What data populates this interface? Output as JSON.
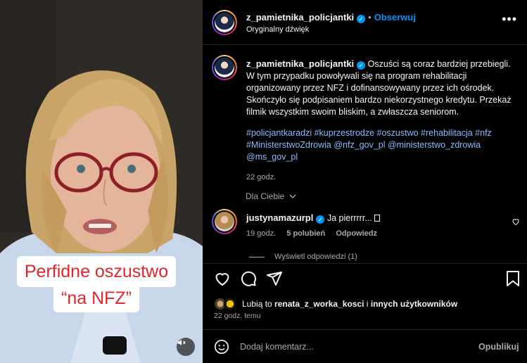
{
  "video": {
    "caption_line1": "Perfidne oszustwo",
    "caption_line2": "“na NFZ”"
  },
  "header": {
    "username": "z_pamietnika_policjantki",
    "separator": "•",
    "follow_label": "Obserwuj",
    "audio_label": "Oryginalny dźwięk",
    "more_label": "•••"
  },
  "post": {
    "username": "z_pamietnika_policjantki",
    "text": "Oszuści są coraz bardziej przebiegli. W tym przypadku powoływali się na program rehabilitacji organizowany przez NFZ i dofinansowywany przez ich ośrodek. Skończyło się podpisaniem bardzo niekorzystnego kredytu. Przekaż filmik wszystkim swoim bliskim, a zwłaszcza seniorom.",
    "hashtags": "#policjantkaradzi #kuprzestrodze #oszustwo #rehabilitacja #nfz #MinisterstwoZdrowia @nfz_gov_pl @ministerstwo_zdrowia @ms_gov_pl",
    "time": "22 godz."
  },
  "filter_label": "Dla Ciebie",
  "comment": {
    "username": "justynamazurpl",
    "text": "Ja pierrrrr... ",
    "time": "19 godz.",
    "likes": "5 polubień",
    "reply": "Odpowiedz",
    "view_replies": "Wyświetl odpowiedzi (1)"
  },
  "likes": {
    "prefix": "Lubią to",
    "user": "renata_z_worka_kosci",
    "mid": "i",
    "others": "innych użytkowników"
  },
  "post_time": "22 godz. temu",
  "composer": {
    "placeholder": "Dodaj komentarz...",
    "publish_label": "Opublikuj"
  },
  "colors": {
    "accent": "#0095f6",
    "caption_red": "#e0262b",
    "muted": "#a8a8a8"
  },
  "icons": [
    "heart-icon",
    "comment-icon",
    "share-icon",
    "bookmark-icon",
    "emoji-icon",
    "mute-icon",
    "more-icon",
    "verified-icon",
    "chevron-down-icon"
  ]
}
